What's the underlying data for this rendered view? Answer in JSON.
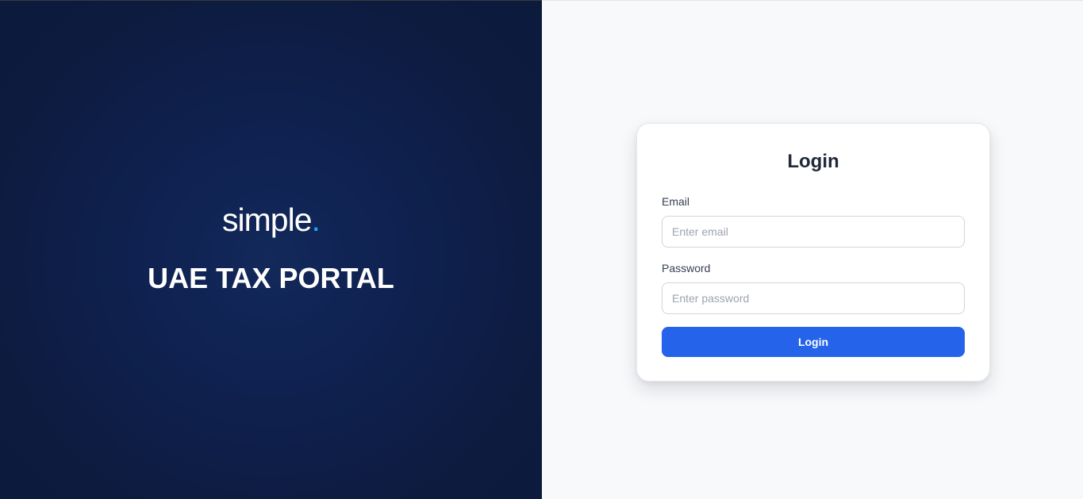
{
  "hero": {
    "brand_text": "simple",
    "brand_dot": ".",
    "title": "UAE TAX PORTAL"
  },
  "login_card": {
    "title": "Login",
    "email_label": "Email",
    "email_placeholder": "Enter email",
    "email_value": "",
    "password_label": "Password",
    "password_placeholder": "Enter password",
    "password_value": "",
    "submit_label": "Login"
  },
  "colors": {
    "hero_background": "#0f2150",
    "brand_accent": "#1aa3ff",
    "page_background": "#f8f9fb",
    "primary_button": "#2563eb"
  }
}
